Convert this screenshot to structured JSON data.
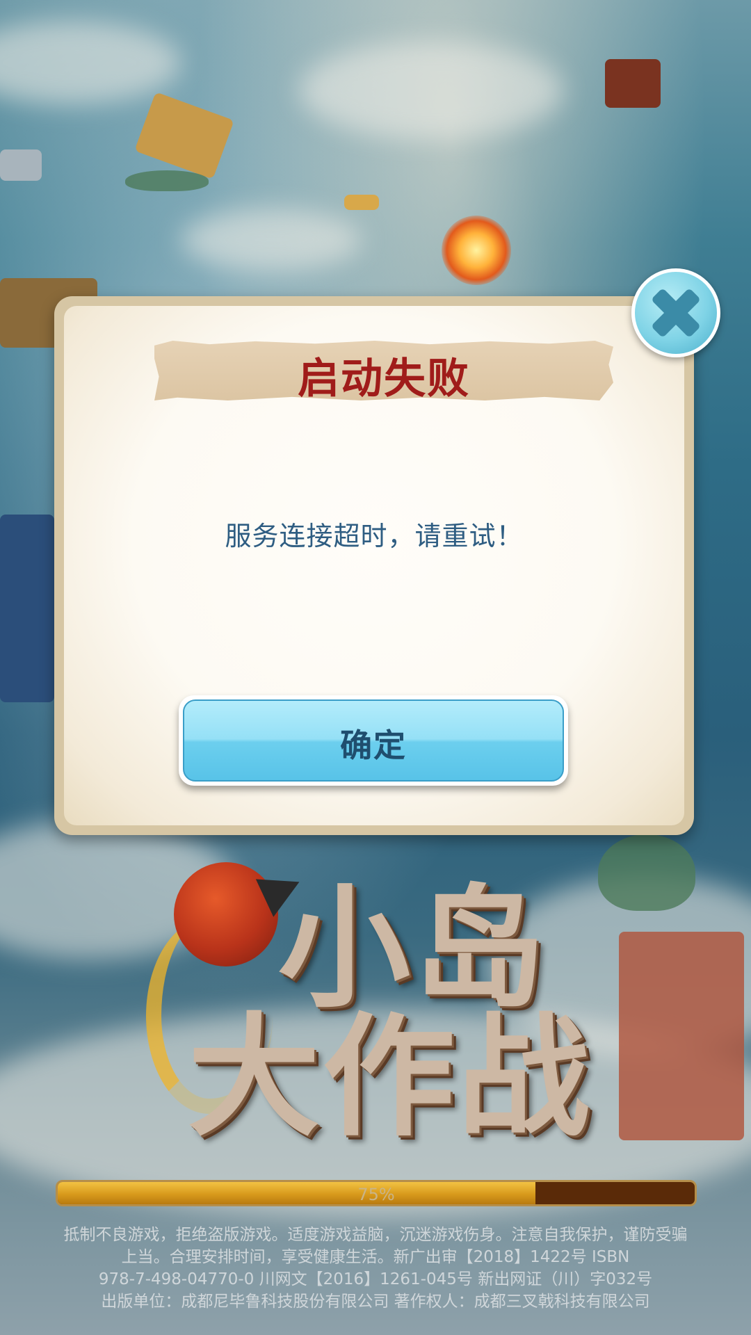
{
  "dialog": {
    "title": "启动失败",
    "message": "服务连接超时，请重试！",
    "confirm_label": "确定"
  },
  "logo": {
    "line1": "小岛",
    "line2": "大作战"
  },
  "progress": {
    "value": 0.75,
    "label": "75%"
  },
  "footer": {
    "lines": [
      "抵制不良游戏，拒绝盗版游戏。适度游戏益脑，沉迷游戏伤身。注意自我保护，谨防受骗",
      "上当。合理安排时间，享受健康生活。新广出审【2018】1422号 ISBN",
      "978-7-498-04770-0 川网文【2016】1261-045号 新出网证（川）字032号",
      "出版单位：成都尼毕鲁科技股份有限公司 著作权人：成都三叉戟科技有限公司"
    ]
  },
  "icons": {
    "close": "close-icon"
  },
  "colors": {
    "title_red": "#a01c1a",
    "message_blue": "#2e5d82",
    "button_cyan": "#6ccfee",
    "progress_gold": "#d89a1c"
  }
}
